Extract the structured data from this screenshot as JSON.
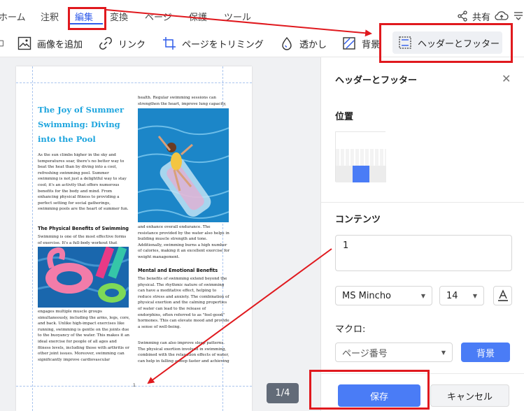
{
  "menu": {
    "items": [
      "ホーム",
      "注釈",
      "編集",
      "変換",
      "ページ",
      "保護",
      "ツール"
    ],
    "share_label": "共有"
  },
  "toolbar": {
    "add_image": "画像を追加",
    "link": "リンク",
    "crop_page": "ページをトリミング",
    "watermark": "透かし",
    "background": "背景",
    "header_footer": "ヘッダーとフッター"
  },
  "document": {
    "title": "The Joy of Summer Swimming: Diving into the Pool",
    "intro": "As the sun climbs higher in the sky and temperatures soar, there's no better way to beat the heat than by diving into a cool, refreshing swimming pool. Summer swimming is not just a delightful way to stay cool; it's an activity that offers numerous benefits for the body and mind. From enhancing physical fitness to providing a perfect setting for social gatherings, swimming pools are the heart of summer fun.",
    "physical_heading": "The Physical Benefits of Swimming",
    "physical_text": "Swimming is one of the most effective forms of exercise. It's a full-body workout that",
    "physical_text_2": "engages multiple muscle groups simultaneously, including the arms, legs, core, and back. Unlike high-impact exercises like running, swimming is gentle on the joints due to the buoyancy of the water. This makes it an ideal exercise for people of all ages and fitness levels, including those with arthritis or other joint issues. Moreover, swimming can significantly improve cardiovascular",
    "right_top_text": "health. Regular swimming sessions can strengthen the heart, improve lung capacity,",
    "right_mid_text": "and enhance overall endurance. The resistance provided by the water also helps in building muscle strength and tone. Additionally, swimming burns a high number of calories, making it an excellent exercise for weight management.",
    "mental_heading": "Mental and Emotional Benefits",
    "mental_text": "The benefits of swimming extend beyond the physical. The rhythmic nature of swimming can have a meditative effect, helping to reduce stress and anxiety. The combination of physical exertion and the calming properties of water can lead to the release of endorphins, often referred to as \"feel-good\" hormones. This can elevate mood and provide a sense of well-being.",
    "mental_text_2": "Swimming can also improve sleep patterns. The physical exertion involved in swimming, combined with the relaxation effects of water, can help in falling asleep faster and achieving",
    "page_number_mark": "1"
  },
  "pager": "1/4",
  "panel": {
    "title": "ヘッダーとフッター",
    "position_label": "位置",
    "content_label": "コンテンツ",
    "content_value": "1",
    "font_name": "MS Mincho",
    "font_size": "14",
    "macro_label": "マクロ:",
    "macro_select": "ページ番号",
    "background_button": "背景",
    "save_button": "保存",
    "cancel_button": "キャンセル"
  },
  "colors": {
    "accent": "#4a7cf6",
    "active_tab": "#2f5bea",
    "annotation_red": "#e0191e",
    "doc_title": "#1ea5de"
  }
}
